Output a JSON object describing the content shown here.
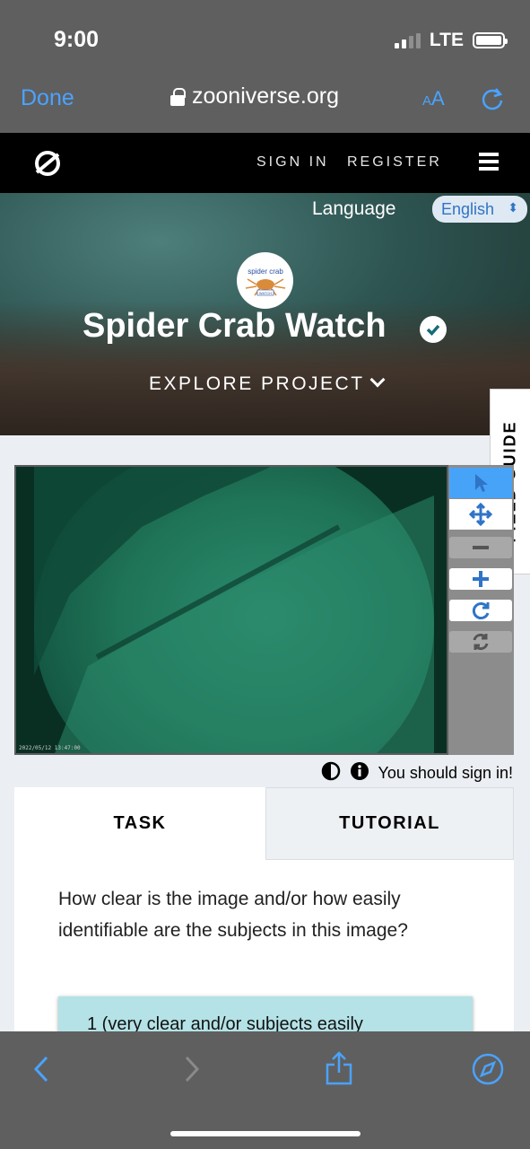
{
  "status_bar": {
    "time": "9:00",
    "network": "LTE"
  },
  "browser": {
    "done_label": "Done",
    "url": "zooniverse.org",
    "text_size_label": "AA"
  },
  "nav": {
    "sign_in": "SIGN IN",
    "register": "REGISTER"
  },
  "hero": {
    "language_label": "Language",
    "language_value": "English",
    "badge_line1": "spider crab",
    "badge_line2": "WATCH",
    "title": "Spider Crab Watch",
    "explore": "EXPLORE PROJECT"
  },
  "field_guide": "FIELD GUIDE",
  "viewer": {
    "timestamp": "2022/05/12 13:47:00"
  },
  "meta": {
    "sign_in_message": "You should sign in!"
  },
  "tabs": {
    "task": "TASK",
    "tutorial": "TUTORIAL"
  },
  "task": {
    "question": "How clear is the image and/or how easily identifiable are the subjects in this image?",
    "answer_1": "1 (very clear and/or subjects easily"
  }
}
